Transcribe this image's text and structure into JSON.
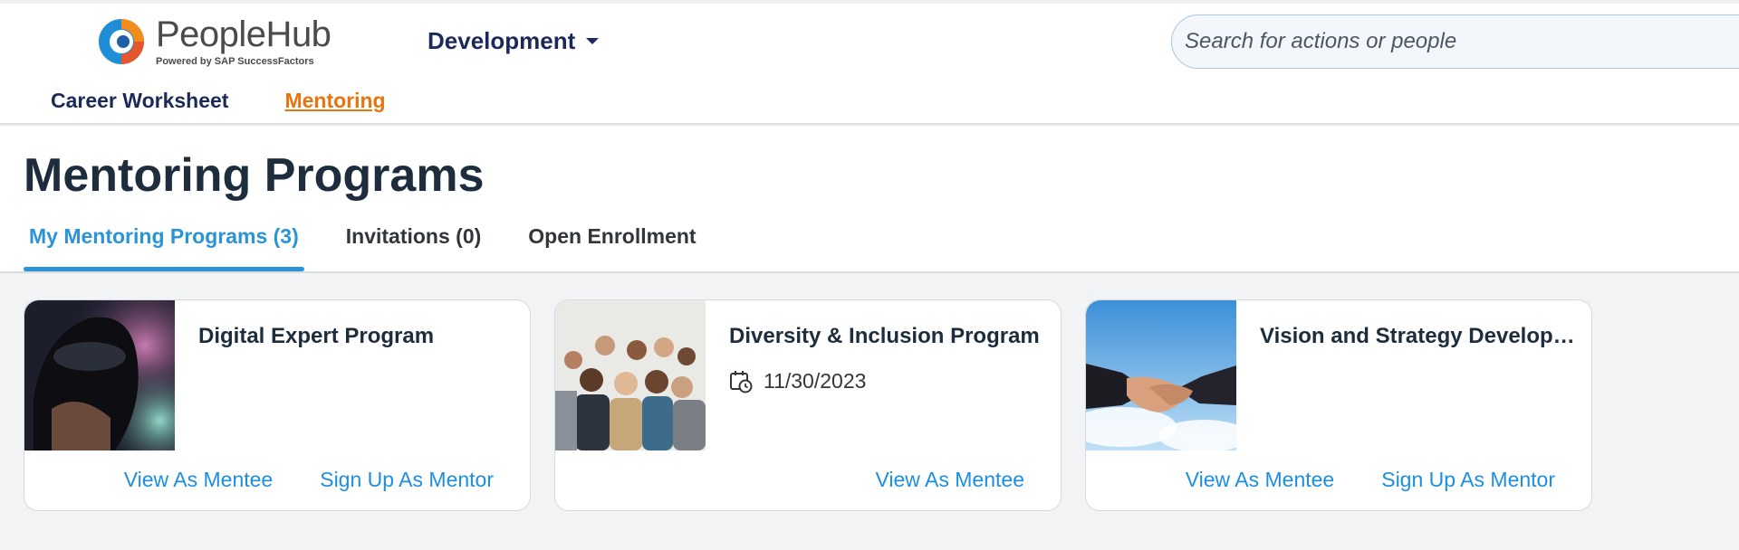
{
  "app": {
    "brand_name": "PeopleHub",
    "brand_sub": "Powered by SAP SuccessFactors",
    "module": "Development",
    "search_placeholder": "Search for actions or people"
  },
  "subnav": {
    "items": [
      {
        "label": "Career Worksheet",
        "active": false
      },
      {
        "label": "Mentoring",
        "active": true
      }
    ]
  },
  "page": {
    "title": "Mentoring Programs",
    "tabs": [
      {
        "label": "My Mentoring Programs (3)",
        "active": true
      },
      {
        "label": "Invitations (0)",
        "active": false
      },
      {
        "label": "Open Enrollment",
        "active": false
      }
    ]
  },
  "cards": [
    {
      "title": "Digital Expert Program",
      "date": "",
      "actions": [
        "View As Mentee",
        "Sign Up As Mentor"
      ]
    },
    {
      "title": "Diversity & Inclusion Program",
      "date": "11/30/2023",
      "actions": [
        "View As Mentee"
      ]
    },
    {
      "title": "Vision and Strategy Developme...",
      "date": "",
      "actions": [
        "View As Mentee",
        "Sign Up As Mentor"
      ]
    }
  ],
  "colors": {
    "accent": "#2a94d6",
    "active_nav": "#e9730c",
    "link": "#1d8ee0",
    "navy": "#1b2a5a"
  }
}
